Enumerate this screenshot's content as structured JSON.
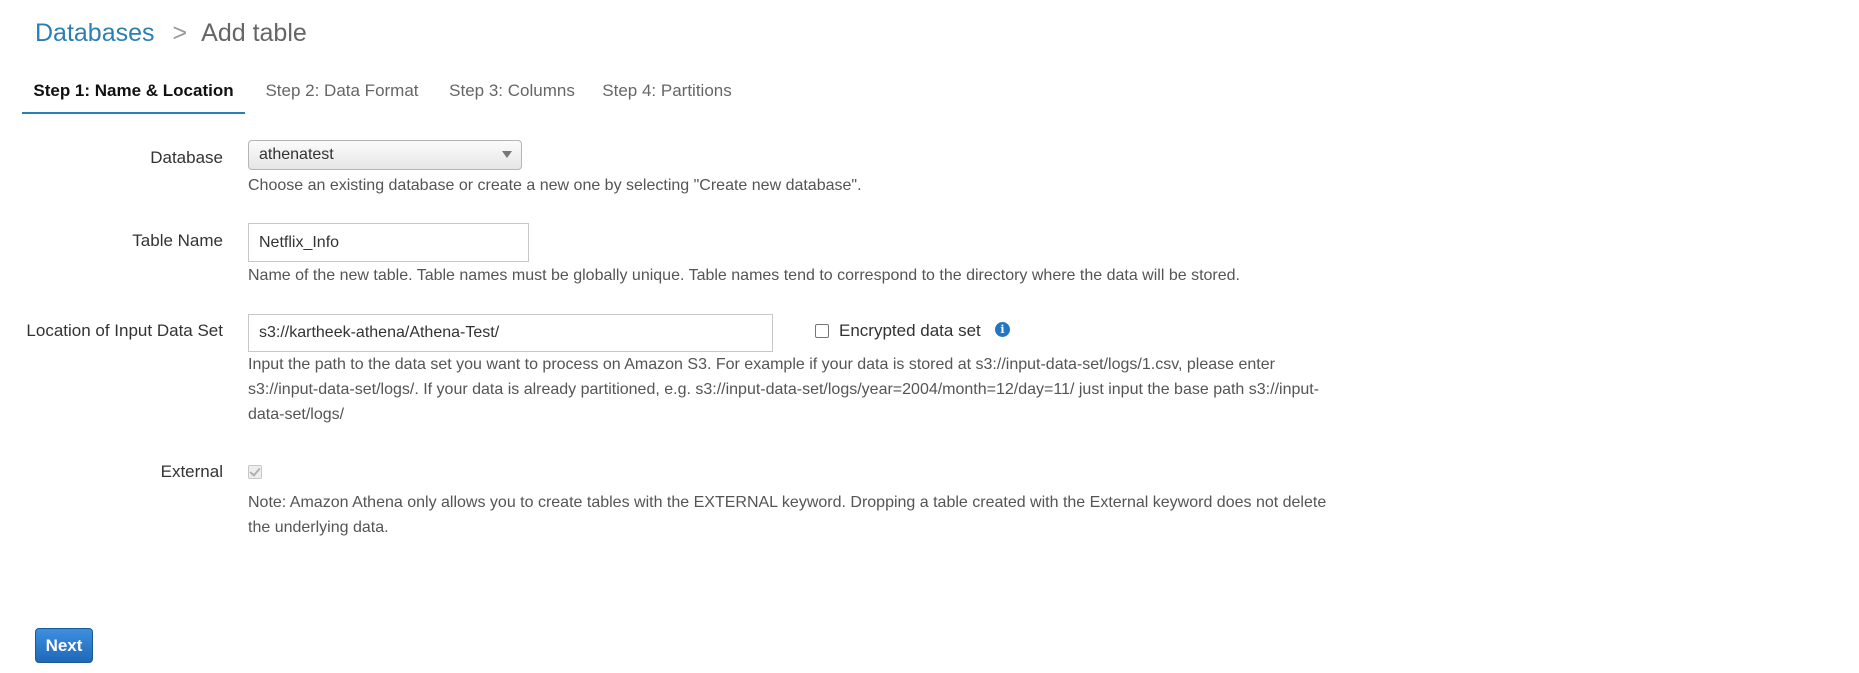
{
  "breadcrumb": {
    "parent": "Databases",
    "separator": ">",
    "current": "Add table"
  },
  "tabs": [
    {
      "label": "Step 1: Name & Location",
      "active": true
    },
    {
      "label": "Step 2: Data Format",
      "active": false
    },
    {
      "label": "Step 3: Columns",
      "active": false
    },
    {
      "label": "Step 4: Partitions",
      "active": false
    }
  ],
  "form": {
    "database": {
      "label": "Database",
      "selected": "athenatest",
      "help": "Choose an existing database or create a new one by selecting \"Create new database\"."
    },
    "table_name": {
      "label": "Table Name",
      "value": "Netflix_Info",
      "help": "Name of the new table. Table names must be globally unique. Table names tend to correspond to the directory where the data will be stored."
    },
    "location": {
      "label": "Location of Input Data Set",
      "value": "s3://kartheek-athena/Athena-Test/",
      "encrypted_label": "Encrypted data set",
      "encrypted_checked": false,
      "info_icon": "info-icon",
      "help_line1": "Input the path to the data set you want to process on Amazon S3. For example if your data is stored at s3://input-data-set/logs/1.csv, please enter",
      "help_line2": "s3://input-data-set/logs/. If your data is already partitioned, e.g. s3://input-data-set/logs/year=2004/month=12/day=11/ just input the base path s3://input-",
      "help_line3": "data-set/logs/"
    },
    "external": {
      "label": "External",
      "checked": true,
      "disabled": true,
      "help_line1": "Note: Amazon Athena only allows you to create tables with the EXTERNAL keyword. Dropping a table created with the External keyword does not delete",
      "help_line2": "the underlying data."
    }
  },
  "actions": {
    "next_label": "Next"
  },
  "colors": {
    "link": "#2b7fb4",
    "tab_underline": "#2b7fb4",
    "primary_button": "#1f68b8",
    "info_icon": "#2277c2"
  }
}
